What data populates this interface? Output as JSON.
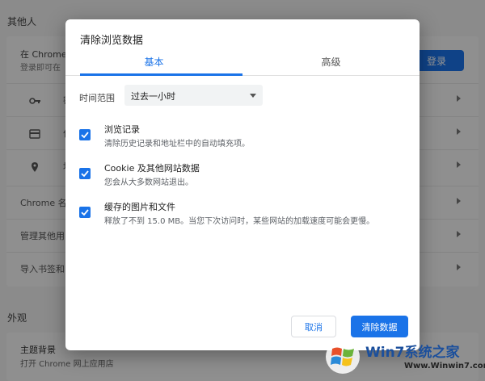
{
  "background": {
    "others_heading": "其他人",
    "signin_text_1": "在 Chrome",
    "signin_text_2": "登录即可在",
    "login_button": "登录",
    "rows": [
      {
        "label": "密"
      },
      {
        "label": "付"
      },
      {
        "label": "地"
      }
    ],
    "chrome_name": "Chrome 名",
    "manage_others": "管理其他用",
    "import_bookmarks": "导入书签和",
    "appearance_heading": "外观",
    "theme_title": "主题背景",
    "theme_sub": "打开 Chrome 网上应用店"
  },
  "dialog": {
    "title": "清除浏览数据",
    "tabs": [
      {
        "label": "基本",
        "active": true
      },
      {
        "label": "高级",
        "active": false
      }
    ],
    "time_range_label": "时间范围",
    "time_range_value": "过去一小时",
    "options": [
      {
        "title": "浏览记录",
        "desc": "清除历史记录和地址栏中的自动填充项。",
        "checked": true
      },
      {
        "title": "Cookie 及其他网站数据",
        "desc": "您会从大多数网站退出。",
        "checked": true
      },
      {
        "title": "缓存的图片和文件",
        "desc": "释放了不到 15.0 MB。当您下次访问时，某些网站的加载速度可能会更慢。",
        "checked": true
      }
    ],
    "cancel_label": "取消",
    "clear_label": "清除数据"
  },
  "watermark": {
    "text": "Win7系统之家",
    "url": "Www.Winwin7.com"
  },
  "colors": {
    "accent": "#1a73e8"
  }
}
